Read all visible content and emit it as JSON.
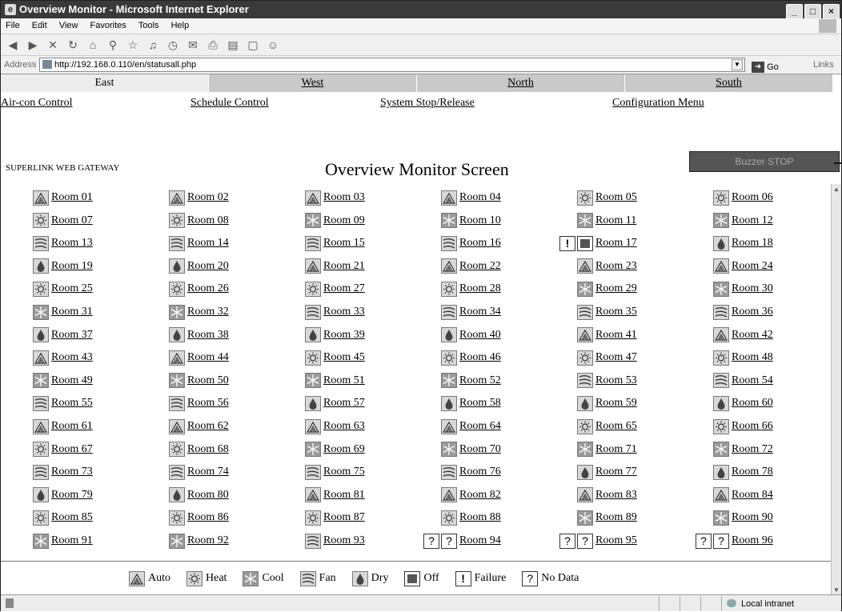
{
  "window": {
    "title": "Overview Monitor - Microsoft Internet Explorer"
  },
  "menu": [
    "File",
    "Edit",
    "View",
    "Favorites",
    "Tools",
    "Help"
  ],
  "address": {
    "label": "Address",
    "url": "http://192.168.0.110/en/statusall.php",
    "go": "Go",
    "links": "Links"
  },
  "tabs": [
    {
      "label": "East",
      "active": true
    },
    {
      "label": "West",
      "active": false
    },
    {
      "label": "North",
      "active": false
    },
    {
      "label": "South",
      "active": false
    }
  ],
  "controls": [
    "Air-con Control",
    "Schedule Control",
    "System Stop/Release",
    "Configuration Menu"
  ],
  "gateway": "SUPERLINK WEB GATEWAY",
  "screen_title": "Overview Monitor Screen",
  "buzzer_label": "Buzzer STOP",
  "rooms": [
    {
      "label": "Room 01",
      "mode": "auto"
    },
    {
      "label": "Room 02",
      "mode": "auto"
    },
    {
      "label": "Room 03",
      "mode": "auto"
    },
    {
      "label": "Room 04",
      "mode": "auto"
    },
    {
      "label": "Room 05",
      "mode": "heat"
    },
    {
      "label": "Room 06",
      "mode": "heat"
    },
    {
      "label": "Room 07",
      "mode": "heat"
    },
    {
      "label": "Room 08",
      "mode": "heat"
    },
    {
      "label": "Room 09",
      "mode": "cool"
    },
    {
      "label": "Room 10",
      "mode": "cool"
    },
    {
      "label": "Room 11",
      "mode": "cool"
    },
    {
      "label": "Room 12",
      "mode": "cool"
    },
    {
      "label": "Room 13",
      "mode": "fan"
    },
    {
      "label": "Room 14",
      "mode": "fan"
    },
    {
      "label": "Room 15",
      "mode": "fan"
    },
    {
      "label": "Room 16",
      "mode": "fan"
    },
    {
      "label": "Room 17",
      "mode": "failure-off"
    },
    {
      "label": "Room 18",
      "mode": "dry"
    },
    {
      "label": "Room 19",
      "mode": "dry"
    },
    {
      "label": "Room 20",
      "mode": "dry"
    },
    {
      "label": "Room 21",
      "mode": "auto"
    },
    {
      "label": "Room 22",
      "mode": "auto"
    },
    {
      "label": "Room 23",
      "mode": "auto"
    },
    {
      "label": "Room 24",
      "mode": "auto"
    },
    {
      "label": "Room 25",
      "mode": "heat"
    },
    {
      "label": "Room 26",
      "mode": "heat"
    },
    {
      "label": "Room 27",
      "mode": "heat"
    },
    {
      "label": "Room 28",
      "mode": "heat"
    },
    {
      "label": "Room 29",
      "mode": "cool"
    },
    {
      "label": "Room 30",
      "mode": "cool"
    },
    {
      "label": "Room 31",
      "mode": "cool"
    },
    {
      "label": "Room 32",
      "mode": "cool"
    },
    {
      "label": "Room 33",
      "mode": "fan"
    },
    {
      "label": "Room 34",
      "mode": "fan"
    },
    {
      "label": "Room 35",
      "mode": "fan"
    },
    {
      "label": "Room 36",
      "mode": "fan"
    },
    {
      "label": "Room 37",
      "mode": "dry"
    },
    {
      "label": "Room 38",
      "mode": "dry"
    },
    {
      "label": "Room 39",
      "mode": "dry"
    },
    {
      "label": "Room 40",
      "mode": "dry"
    },
    {
      "label": "Room 41",
      "mode": "auto"
    },
    {
      "label": "Room 42",
      "mode": "auto"
    },
    {
      "label": "Room 43",
      "mode": "auto"
    },
    {
      "label": "Room 44",
      "mode": "auto"
    },
    {
      "label": "Room 45",
      "mode": "heat"
    },
    {
      "label": "Room 46",
      "mode": "heat"
    },
    {
      "label": "Room 47",
      "mode": "heat"
    },
    {
      "label": "Room 48",
      "mode": "heat"
    },
    {
      "label": "Room 49",
      "mode": "cool"
    },
    {
      "label": "Room 50",
      "mode": "cool"
    },
    {
      "label": "Room 51",
      "mode": "cool"
    },
    {
      "label": "Room 52",
      "mode": "cool"
    },
    {
      "label": "Room 53",
      "mode": "fan"
    },
    {
      "label": "Room 54",
      "mode": "fan"
    },
    {
      "label": "Room 55",
      "mode": "fan"
    },
    {
      "label": "Room 56",
      "mode": "fan"
    },
    {
      "label": "Room 57",
      "mode": "dry"
    },
    {
      "label": "Room 58",
      "mode": "dry"
    },
    {
      "label": "Room 59",
      "mode": "dry"
    },
    {
      "label": "Room 60",
      "mode": "dry"
    },
    {
      "label": "Room 61",
      "mode": "auto"
    },
    {
      "label": "Room 62",
      "mode": "auto"
    },
    {
      "label": "Room 63",
      "mode": "auto"
    },
    {
      "label": "Room 64",
      "mode": "auto"
    },
    {
      "label": "Room 65",
      "mode": "heat"
    },
    {
      "label": "Room 66",
      "mode": "heat"
    },
    {
      "label": "Room 67",
      "mode": "heat"
    },
    {
      "label": "Room 68",
      "mode": "heat"
    },
    {
      "label": "Room 69",
      "mode": "cool"
    },
    {
      "label": "Room 70",
      "mode": "cool"
    },
    {
      "label": "Room 71",
      "mode": "cool"
    },
    {
      "label": "Room 72",
      "mode": "cool"
    },
    {
      "label": "Room 73",
      "mode": "fan"
    },
    {
      "label": "Room 74",
      "mode": "fan"
    },
    {
      "label": "Room 75",
      "mode": "fan"
    },
    {
      "label": "Room 76",
      "mode": "fan"
    },
    {
      "label": "Room 77",
      "mode": "dry"
    },
    {
      "label": "Room 78",
      "mode": "dry"
    },
    {
      "label": "Room 79",
      "mode": "dry"
    },
    {
      "label": "Room 80",
      "mode": "dry"
    },
    {
      "label": "Room 81",
      "mode": "auto"
    },
    {
      "label": "Room 82",
      "mode": "auto"
    },
    {
      "label": "Room 83",
      "mode": "auto"
    },
    {
      "label": "Room 84",
      "mode": "auto"
    },
    {
      "label": "Room 85",
      "mode": "heat"
    },
    {
      "label": "Room 86",
      "mode": "heat"
    },
    {
      "label": "Room 87",
      "mode": "heat"
    },
    {
      "label": "Room 88",
      "mode": "heat"
    },
    {
      "label": "Room 89",
      "mode": "cool"
    },
    {
      "label": "Room 90",
      "mode": "cool"
    },
    {
      "label": "Room 91",
      "mode": "cool"
    },
    {
      "label": "Room 92",
      "mode": "cool"
    },
    {
      "label": "Room 93",
      "mode": "fan"
    },
    {
      "label": "Room 94",
      "mode": "nodata"
    },
    {
      "label": "Room 95",
      "mode": "nodata"
    },
    {
      "label": "Room 96",
      "mode": "nodata"
    }
  ],
  "legend": [
    {
      "mode": "auto",
      "label": "Auto"
    },
    {
      "mode": "heat",
      "label": "Heat"
    },
    {
      "mode": "cool",
      "label": "Cool"
    },
    {
      "mode": "fan",
      "label": "Fan"
    },
    {
      "mode": "dry",
      "label": "Dry"
    },
    {
      "mode": "off",
      "label": "Off"
    },
    {
      "mode": "failure",
      "label": "Failure"
    },
    {
      "mode": "nodata",
      "label": "No Data"
    }
  ],
  "icon_glyphs": {
    "nodata": "?",
    "failure": "!"
  },
  "status": {
    "zone": "Local intranet"
  }
}
